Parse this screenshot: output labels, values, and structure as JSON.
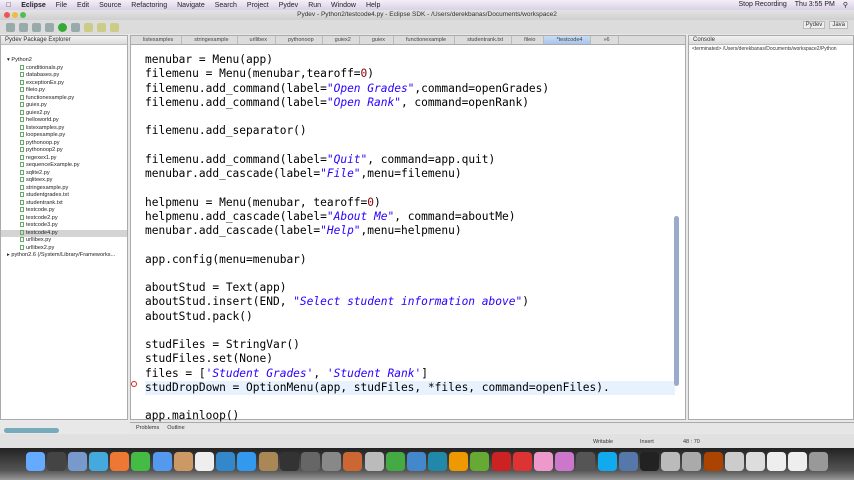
{
  "menubar": {
    "app": "Eclipse",
    "items": [
      "File",
      "Edit",
      "Source",
      "Refactoring",
      "Navigate",
      "Search",
      "Project",
      "Pydev",
      "Run",
      "Window",
      "Help"
    ],
    "status": [
      "Stop Recording",
      "Thu 3:55 PM"
    ]
  },
  "window": {
    "title": "Pydev - Python2/testcode4.py - Eclipse SDK - /Users/derekbanas/Documents/workspace2"
  },
  "perspectives": [
    "Pydev",
    "Java"
  ],
  "explorer": {
    "title": "Pydev Package Explorer",
    "project": "Python2",
    "files": [
      "conditionals.py",
      "databases.py",
      "exceptionEx.py",
      "fileio.py",
      "functionexample.py",
      "guiex.py",
      "guiex2.py",
      "helloworld.py",
      "listexamples.py",
      "loopexample.py",
      "pythonoop.py",
      "pythonoop2.py",
      "regexex1.py",
      "sequenceExample.py",
      "sqlite2.py",
      "sqliteex.py",
      "stringexample.py",
      "studentgrades.txt",
      "studentrank.txt",
      "testcode.py",
      "testcode2.py",
      "testcode3.py",
      "testcode4.py",
      "urllibex.py",
      "urllibex2.py"
    ],
    "selected": "testcode4.py",
    "library": "python2.6 (/System/Library/Frameworks..."
  },
  "editor": {
    "tabs": [
      "listexamples",
      "stringexample",
      "urllibex",
      "pythonoop",
      "guiex2",
      "guiex",
      "functionexample",
      "studentrank.txt",
      "fileio",
      "*testcode4",
      "»6"
    ],
    "active_tab": 9,
    "lines": [
      [
        [
          "menubar = Menu(app)",
          ""
        ]
      ],
      [
        [
          "filemenu = Menu(menubar,tearoff=",
          ""
        ],
        [
          "0",
          "n"
        ],
        [
          ")",
          ""
        ]
      ],
      [
        [
          "filemenu.add_command(label=",
          ""
        ],
        [
          "\"Open Grades\"",
          "s"
        ],
        [
          ",command=openGrades)",
          ""
        ]
      ],
      [
        [
          "filemenu.add_command(label=",
          ""
        ],
        [
          "\"Open Rank\"",
          "s"
        ],
        [
          ", command=openRank)",
          ""
        ]
      ],
      [],
      [
        [
          "filemenu.add_separator()",
          ""
        ]
      ],
      [],
      [
        [
          "filemenu.add_command(label=",
          ""
        ],
        [
          "\"Quit\"",
          "s"
        ],
        [
          ", command=app.quit)",
          ""
        ]
      ],
      [
        [
          "menubar.add_cascade(label=",
          ""
        ],
        [
          "\"File\"",
          "s"
        ],
        [
          ",menu=filemenu)",
          ""
        ]
      ],
      [],
      [
        [
          "helpmenu = Menu(menubar, tearoff=",
          ""
        ],
        [
          "0",
          "n"
        ],
        [
          ")",
          ""
        ]
      ],
      [
        [
          "helpmenu.add_cascade(label=",
          ""
        ],
        [
          "\"About Me\"",
          "s"
        ],
        [
          ", command=aboutMe)",
          ""
        ]
      ],
      [
        [
          "menubar.add_cascade(label=",
          ""
        ],
        [
          "\"Help\"",
          "s"
        ],
        [
          ",menu=helpmenu)",
          ""
        ]
      ],
      [],
      [
        [
          "app.config(menu=menubar)",
          ""
        ]
      ],
      [],
      [
        [
          "aboutStud = Text(app)",
          ""
        ]
      ],
      [
        [
          "aboutStud.insert(END, ",
          ""
        ],
        [
          "\"Select student information above\"",
          "s"
        ],
        [
          ")",
          ""
        ]
      ],
      [
        [
          "aboutStud.pack()",
          ""
        ]
      ],
      [],
      [
        [
          "studFiles = StringVar()",
          ""
        ]
      ],
      [
        [
          "studFiles.set(None)",
          ""
        ]
      ],
      [
        [
          "files = [",
          ""
        ],
        [
          "'Student Grades'",
          "s"
        ],
        [
          ", ",
          ""
        ],
        [
          "'Student Rank'",
          "s"
        ],
        [
          "]",
          ""
        ]
      ],
      [
        [
          "studDropDown = OptionMenu(app, studFiles, *files, command=openFiles).",
          ""
        ]
      ],
      [],
      [
        [
          "app.mainloop()",
          ""
        ]
      ]
    ],
    "current_line": 23
  },
  "console": {
    "title": "Console",
    "path": "<terminated> /Users/derekbanas/Documents/workspace2/Python"
  },
  "bottom_tabs": [
    "Problems",
    "Outline"
  ],
  "status": {
    "mode": "Writable",
    "insert": "Insert",
    "position": "48 : 70"
  },
  "dock": [
    "Finder",
    "Dashboard",
    "Preview",
    "Safari",
    "Firefox",
    "Chrome",
    "iChat",
    "Address Book",
    "iCal",
    "iTunes",
    "App Store",
    "Photo Booth",
    "iMovie",
    "Mission Control",
    "System Preferences",
    "Keynote",
    "Pen",
    "Numbers",
    "Xcode",
    "Photoshop",
    "Illustrator",
    "Dreamweaver",
    "Flash",
    "Acrobat",
    "TextEdit",
    "Cleaner",
    "Clapper",
    "Skype",
    "Network",
    "Terminal",
    "Calculator",
    "Activity",
    "Bridge",
    "Documents",
    "Downloads",
    "Files",
    "Notes",
    "Trash"
  ],
  "colors": {
    "string": "#2a00ff",
    "active_tab": "#a9c4ea",
    "current_line": "#e8f2fe",
    "error": "#dd2222"
  }
}
